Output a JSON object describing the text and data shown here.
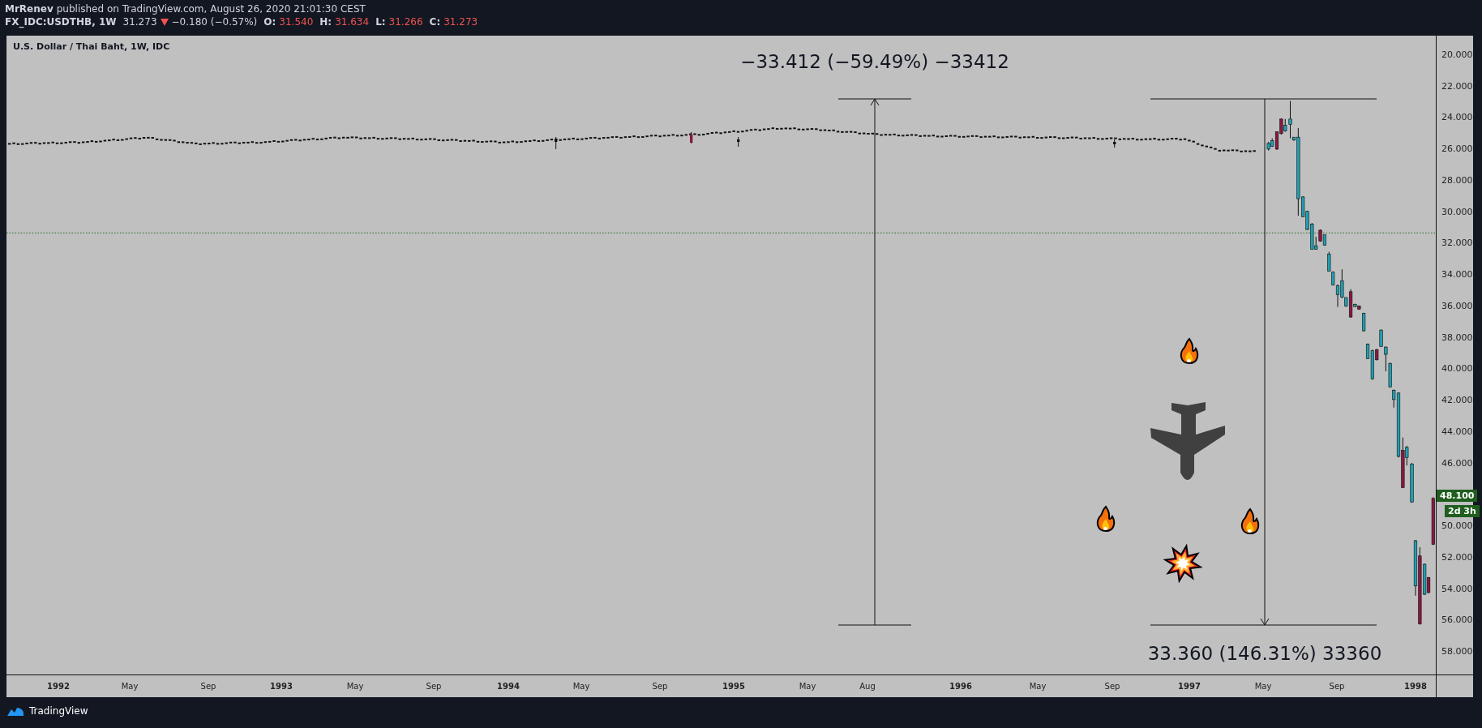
{
  "header": {
    "author": "MrRenev",
    "published": "published on TradingView.com, August 26, 2020 21:01:30 CEST"
  },
  "quote": {
    "symbol": "FX_IDC:USDTHB, 1W",
    "last": "31.273",
    "down": true,
    "change": "−0.180 (−0.57%)",
    "ohlc": [
      {
        "label": "O:",
        "value": "31.540"
      },
      {
        "label": "H:",
        "value": "31.634"
      },
      {
        "label": "L:",
        "value": "31.266"
      },
      {
        "label": "C:",
        "value": "31.273"
      }
    ]
  },
  "chart": {
    "title": "U.S. Dollar / Thai Baht, 1W, IDC",
    "measurements": [
      {
        "label": "−33.412 (−59.49%) −33412",
        "pointing_up": true
      },
      {
        "label": "33.360 (146.31%) 33360",
        "pointing_up": false
      }
    ],
    "price_axis": {
      "labels": [
        "20.000",
        "22.000",
        "24.000",
        "26.000",
        "28.000",
        "30.000",
        "32.000",
        "34.000",
        "36.000",
        "38.000",
        "40.000",
        "42.000",
        "44.000",
        "46.000",
        "50.000",
        "52.000",
        "54.000",
        "56.000",
        "58.000"
      ],
      "last_price": "48.100",
      "countdown": "2d 3h"
    },
    "time_axis": [
      {
        "text": "1992",
        "kind": "year"
      },
      {
        "text": "May",
        "kind": "month"
      },
      {
        "text": "Sep",
        "kind": "month"
      },
      {
        "text": "1993",
        "kind": "year"
      },
      {
        "text": "May",
        "kind": "month"
      },
      {
        "text": "Sep",
        "kind": "month"
      },
      {
        "text": "1994",
        "kind": "year"
      },
      {
        "text": "May",
        "kind": "month"
      },
      {
        "text": "Sep",
        "kind": "month"
      },
      {
        "text": "1995",
        "kind": "year"
      },
      {
        "text": "May",
        "kind": "month"
      },
      {
        "text": "Aug",
        "kind": "month"
      },
      {
        "text": "1996",
        "kind": "year"
      },
      {
        "text": "May",
        "kind": "month"
      },
      {
        "text": "Sep",
        "kind": "month"
      },
      {
        "text": "1997",
        "kind": "year"
      },
      {
        "text": "May",
        "kind": "month"
      },
      {
        "text": "Sep",
        "kind": "month"
      },
      {
        "text": "1998",
        "kind": "year"
      }
    ]
  },
  "footer": {
    "brand": "TradingView"
  }
}
